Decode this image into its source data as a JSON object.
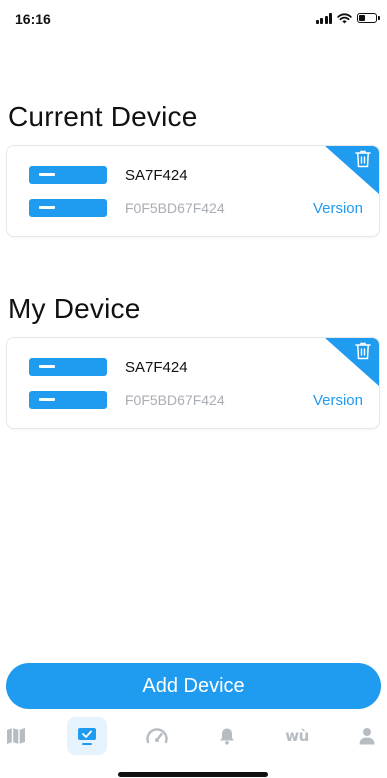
{
  "status_bar": {
    "time": "16:16"
  },
  "sections": {
    "current_title": "Current Device",
    "my_title": "My Device"
  },
  "current_device": {
    "name": "SA7F424",
    "mac": "F0F5BD67F424",
    "version_label": "Version"
  },
  "my_device": {
    "name": "SA7F424",
    "mac": "F0F5BD67F424",
    "version_label": "Version"
  },
  "add_button": {
    "label": "Add Device"
  },
  "tab_bar": {
    "active": "device",
    "tabs": [
      {
        "icon": "map-icon"
      },
      {
        "icon": "device-icon"
      },
      {
        "icon": "speedometer-icon"
      },
      {
        "icon": "bell-icon"
      },
      {
        "icon": "wu-icon",
        "text": "wù"
      },
      {
        "icon": "user-icon"
      }
    ]
  },
  "colors": {
    "accent": "#1f9bf0",
    "muted_text": "#a9adb4",
    "tab_inactive": "#b7bcc3",
    "tab_active_bg": "#e6f3fc"
  }
}
